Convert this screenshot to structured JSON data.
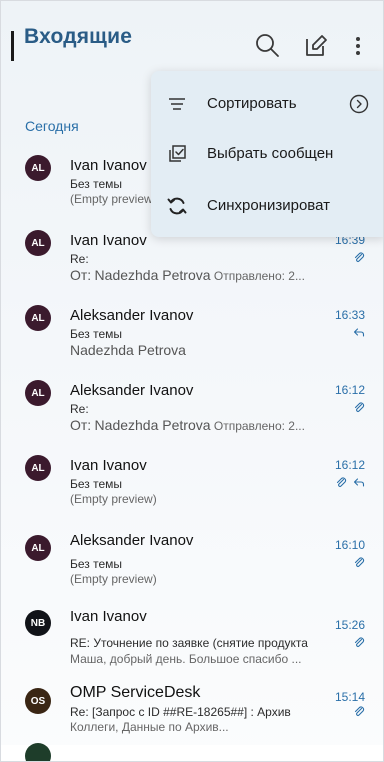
{
  "header": {
    "title": "Входящие",
    "icons": [
      "search-icon",
      "compose-icon",
      "more-vertical-icon"
    ]
  },
  "section": {
    "label": "Сегодня"
  },
  "colors": {
    "accent": "#2a5c86",
    "link": "#2a6fa8",
    "menu_bg": "#e3edf4"
  },
  "menu": {
    "items": [
      {
        "label": "Сортировать",
        "icon": "sort-lines-icon",
        "trailing_icon": "chevron-right-circle-icon"
      },
      {
        "label": "Выбрать сообщен",
        "icon": "select-messages-icon"
      },
      {
        "label": "Синхронизироват",
        "icon": "sync-icon"
      }
    ]
  },
  "messages": [
    {
      "avatar": "AL",
      "avatar_color": "#3b1a2d",
      "sender": "Ivan Ivanov",
      "time": "",
      "line2": "Без темы",
      "line3": "(Empty preview)",
      "icons": []
    },
    {
      "avatar": "AL",
      "avatar_color": "#3b1a2d",
      "sender": "Ivan Ivanov",
      "time": "16:39",
      "line2": "Re:",
      "line3_prefix": "От:",
      "line3_name": "Nadezhda Petrova",
      "line3_suffix": "Отправлено: 2...",
      "icons": [
        "paperclip-icon"
      ]
    },
    {
      "avatar": "AL",
      "avatar_color": "#3b1a2d",
      "sender": "Aleksander Ivanov",
      "time": "16:33",
      "line2": "Без темы",
      "line3": "Nadezhda Petrova",
      "icons": [
        "reply-icon"
      ]
    },
    {
      "avatar": "AL",
      "avatar_color": "#3b1a2d",
      "sender": "Aleksander Ivanov",
      "time": "16:12",
      "line2": "Re:",
      "line3_prefix": "От:",
      "line3_name": "Nadezhda Petrova",
      "line3_suffix": "Отправлено: 2...",
      "icons": [
        "paperclip-icon"
      ]
    },
    {
      "avatar": "AL",
      "avatar_color": "#3b1a2d",
      "sender": "Ivan Ivanov",
      "time": "16:12",
      "line2": "Без темы",
      "line3": "(Empty preview)",
      "icons": [
        "paperclip-icon",
        "reply-icon"
      ]
    },
    {
      "avatar": "AL",
      "avatar_color": "#3b1a2d",
      "sender": "Aleksander Ivanov",
      "time": "16:10",
      "line2": "Без темы",
      "line3": "(Empty preview)",
      "icons": [
        "paperclip-icon"
      ]
    },
    {
      "avatar": "NB",
      "avatar_color": "#111318",
      "sender": "Ivan Ivanov",
      "time": "15:26",
      "line2": "RE: Уточнение по заявке (снятие продукта",
      "line3": "Маша, добрый день. Большое спасибо ...",
      "icons": [
        "paperclip-icon"
      ]
    },
    {
      "avatar": "OS",
      "avatar_color": "#3a2614",
      "sender": "OMP ServiceDesk",
      "time": "15:14",
      "line2": "Re: [Запрос с ID ##RE-18265##] : Архив",
      "line3": "Коллеги, Данные по Архив...",
      "icons": [
        "paperclip-icon"
      ]
    }
  ]
}
